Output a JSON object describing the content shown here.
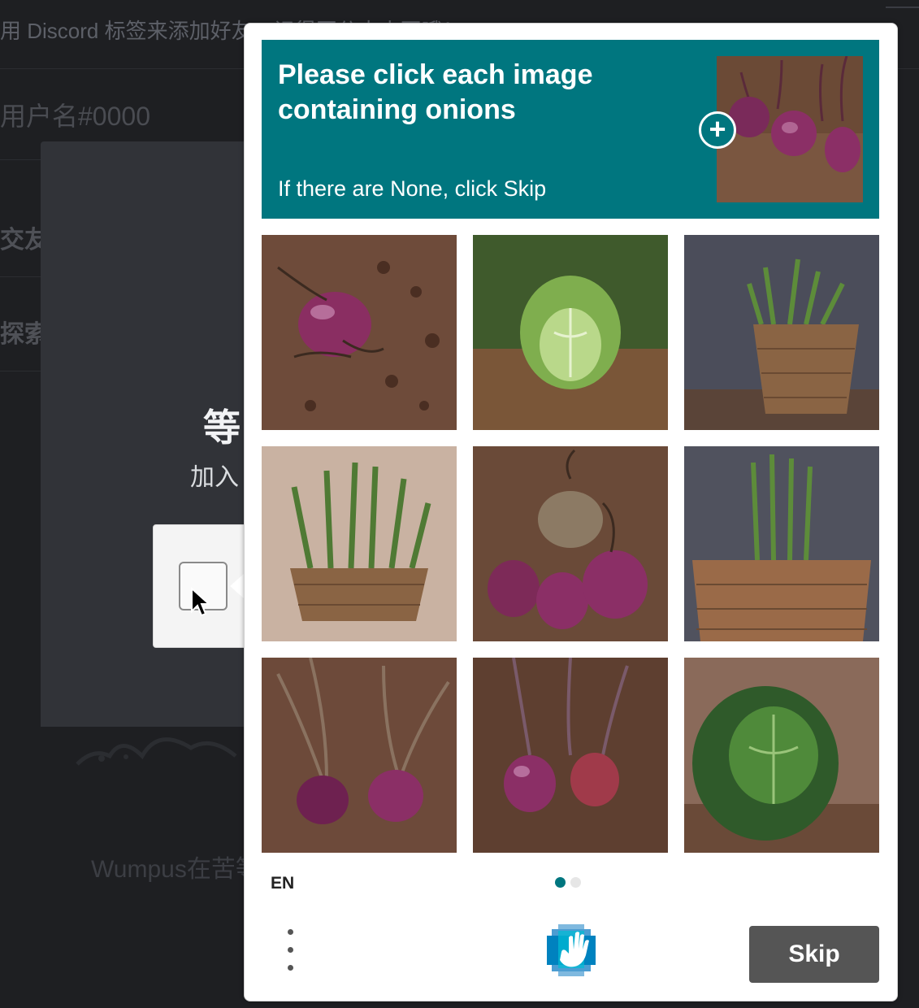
{
  "background": {
    "header_text": "用 Discord 标签来添加好友，记得区分大小写哦！",
    "username_placeholder": "用户名#0000",
    "sidebar_items": [
      "交友",
      "探索"
    ],
    "wait_title": "等",
    "wait_sub": "加入",
    "wumpus_text": "Wumpus在苦等"
  },
  "challenge": {
    "prompt": "Please click each image containing onions",
    "subprompt": "If there are None, click Skip",
    "example_icon": "zoom-plus-icon",
    "tiles": [
      {
        "subject": "onion"
      },
      {
        "subject": "cabbage"
      },
      {
        "subject": "asparagus"
      },
      {
        "subject": "asparagus"
      },
      {
        "subject": "onion"
      },
      {
        "subject": "asparagus"
      },
      {
        "subject": "onion"
      },
      {
        "subject": "onion"
      },
      {
        "subject": "cabbage"
      }
    ],
    "language": "EN",
    "page_count": 2,
    "current_page": 1,
    "skip_label": "Skip",
    "menu_icon": "more-vertical-icon",
    "logo_icon": "hcaptcha-logo-icon",
    "accent_color": "#00767f"
  }
}
